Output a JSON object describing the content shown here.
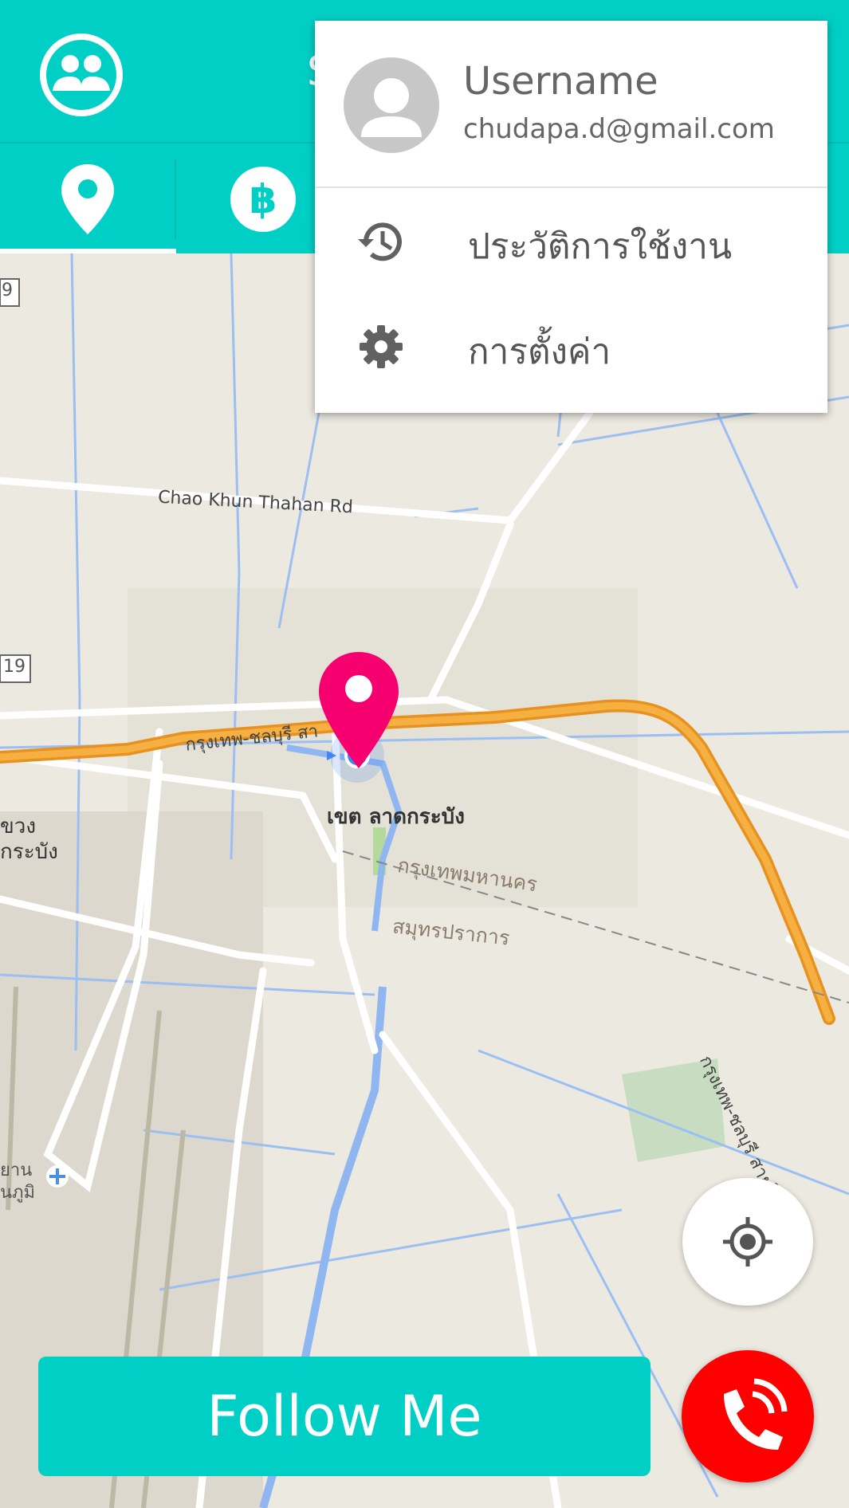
{
  "header": {
    "title": "S",
    "profile_icon": "group-icon"
  },
  "tabs": [
    {
      "name": "location",
      "icon": "location-pin-icon",
      "active": true
    },
    {
      "name": "bitcoin",
      "icon": "bitcoin-icon",
      "active": false
    }
  ],
  "menu": {
    "username": "Username",
    "email": "chudapa.d@gmail.com",
    "avatar_icon": "person-icon",
    "items": [
      {
        "label": "ประวัติการใช้งาน",
        "icon": "history-icon"
      },
      {
        "label": "การตั้งค่า",
        "icon": "gear-icon"
      }
    ]
  },
  "map": {
    "labels": {
      "road1": "Chao Khun Thahan Rd",
      "road2": "กรุงเทพ-ชลบุรี สา",
      "district": "เขต ลาดกระบัง",
      "area1": "กรุงเทพมหานคร",
      "area2": "สมุทรปราการ",
      "left1": "ขวง",
      "left2": "กระบัง",
      "left3": "ยาน",
      "left4": "นภูมิ",
      "road3": "กรุงเทพ-ชลบุรี สายใ",
      "shield1": "9",
      "shield2": "19"
    }
  },
  "controls": {
    "follow_label": "Follow Me",
    "locate_icon": "my-location-icon",
    "call_icon": "phone-call-icon"
  },
  "colors": {
    "accent": "#00cfc5",
    "pin": "#f5006e",
    "call": "#ff0000",
    "highway": "#f2a127"
  }
}
